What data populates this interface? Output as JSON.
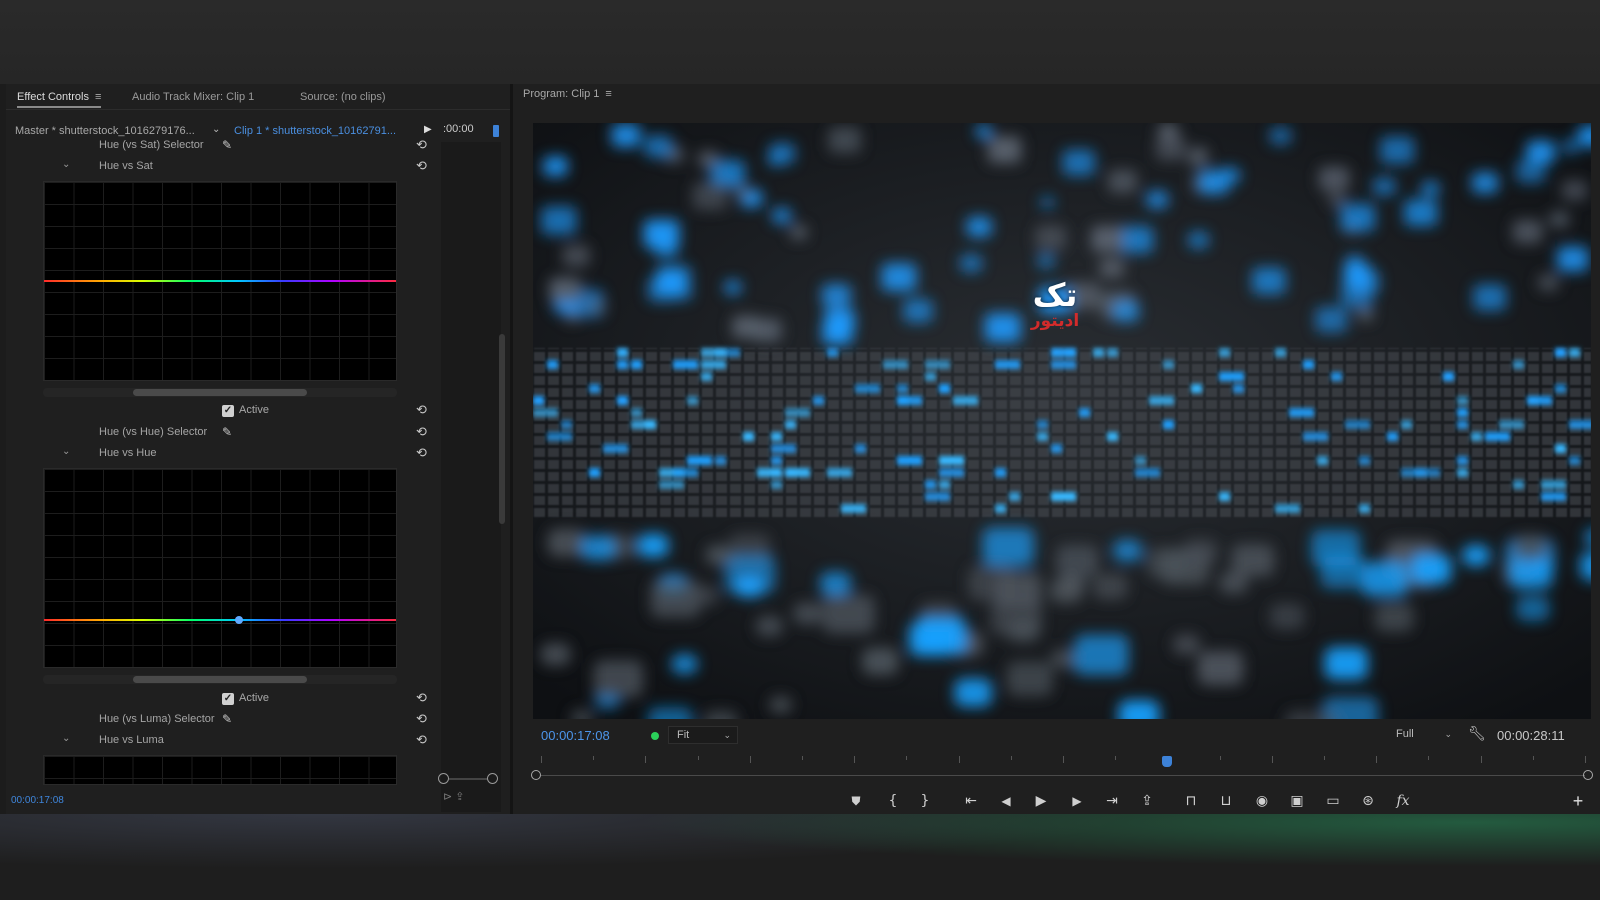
{
  "left_panel": {
    "tabs": [
      {
        "label": "Effect Controls",
        "active": true,
        "menu_icon": "hamburger-menu-icon"
      },
      {
        "label": "Audio Track Mixer: Clip 1",
        "active": false
      },
      {
        "label": "Source: (no clips)",
        "active": false
      }
    ],
    "master_label": "Master * shutterstock_1016279176...",
    "clip_label": "Clip 1 * shutterstock_10162791...",
    "timeline_time": ":00:00",
    "hue_vs_sat_selector": "Hue (vs Sat) Selector",
    "hue_vs_sat": "Hue vs Sat",
    "active_1": "Active",
    "hue_vs_hue_selector": "Hue (vs Hue) Selector",
    "hue_vs_hue": "Hue vs Hue",
    "active_2": "Active",
    "hue_vs_luma_selector": "Hue (vs Luma) Selector",
    "hue_vs_luma": "Hue vs Luma",
    "bottom_timecode": "00:00:17:08"
  },
  "program_monitor": {
    "title": "Program: Clip 1",
    "current_time": "00:00:17:08",
    "fit_select": "Fit",
    "resolution_select": "Full",
    "duration": "00:00:28:11",
    "watermark_top": "تک",
    "watermark_bottom": "ادیتور",
    "playhead_fraction": 0.6,
    "accent_color": "#3d82d8",
    "timecode_color": "#4c95ea"
  },
  "transport_icons": [
    "add-marker-icon",
    "mark-in-icon",
    "mark-out-icon",
    "go-to-in-icon",
    "step-back-icon",
    "play-icon",
    "step-forward-icon",
    "go-to-out-icon",
    "lift-icon",
    "extract-icon",
    "insert-icon",
    "overwrite-icon",
    "export-frame-icon",
    "comparison-view-icon",
    "safe-margins-icon",
    "vr-icon",
    "fx-icon"
  ]
}
